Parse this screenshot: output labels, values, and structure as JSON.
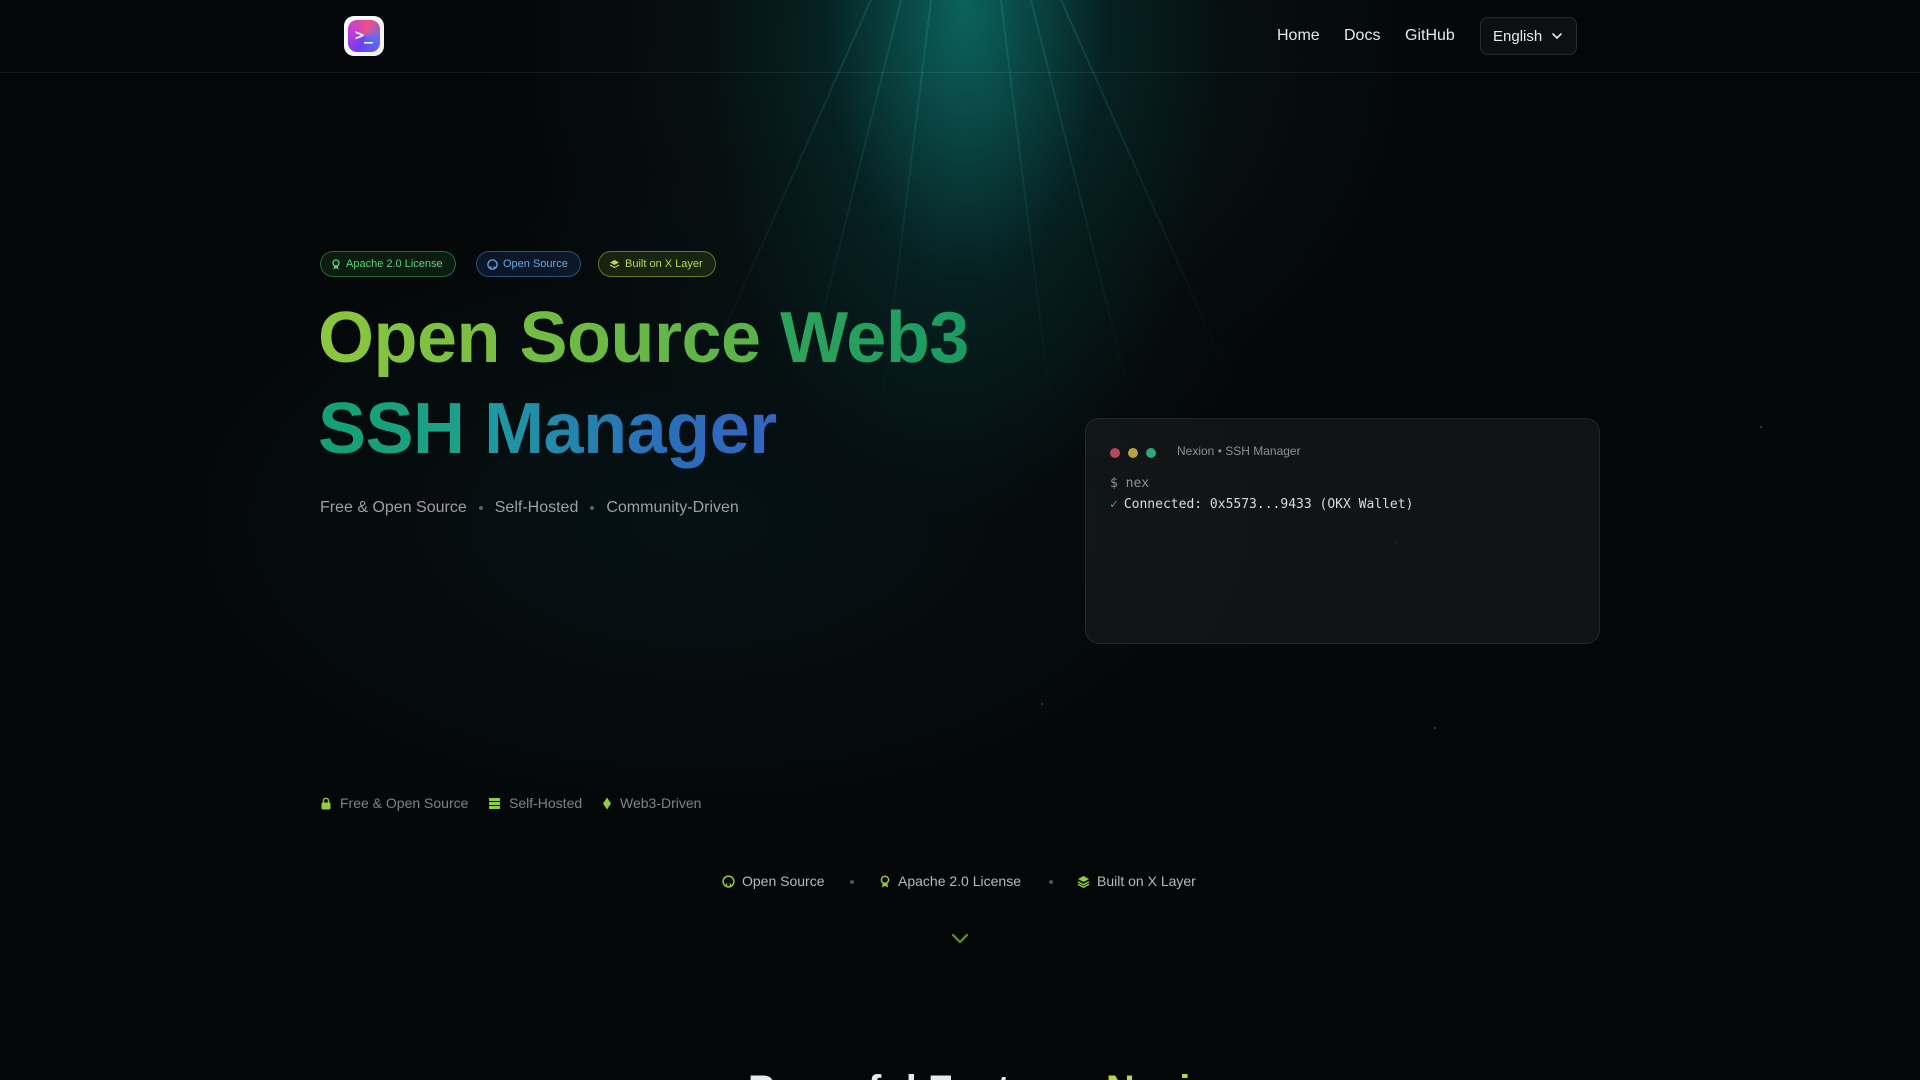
{
  "header": {
    "logo_alt": "",
    "nav": [
      {
        "label": "Home"
      },
      {
        "label": "Docs"
      },
      {
        "label": "GitHub"
      }
    ],
    "language": "English"
  },
  "hero": {
    "badges": [
      {
        "label": "Apache 2.0 License",
        "icon": "license-icon",
        "color": "#5fd07c"
      },
      {
        "label": "Open Source",
        "icon": "github-icon",
        "color": "#6aa8e8"
      },
      {
        "label": "Built on X Layer",
        "icon": "layers-icon",
        "color": "#b9d75a"
      }
    ],
    "title_part1": "Open Source",
    "title_part2": "Web3",
    "title_part3": "SSH",
    "title_part4": "Manager",
    "subtitle": [
      "Free & Open Source",
      "Self-Hosted",
      "Community-Driven"
    ]
  },
  "terminal": {
    "title": "Nexion • SSH Manager",
    "line1": "$ nex",
    "line2_check": "✓",
    "line2": "Connected: 0x5573...9433 (OKX Wallet)",
    "dot_colors": [
      "#b9475a",
      "#b5a13e",
      "#2fa67a"
    ]
  },
  "features": [
    {
      "label": "Free & Open Source",
      "icon": "lock-icon"
    },
    {
      "label": "Self-Hosted",
      "icon": "server-icon"
    },
    {
      "label": "Web3-Driven",
      "icon": "ethereum-icon"
    }
  ],
  "bottom_badges": [
    {
      "label": "Open Source",
      "icon": "github-icon"
    },
    {
      "label": "Apache 2.0 License",
      "icon": "license-icon"
    },
    {
      "label": "Built on X Layer",
      "icon": "layers-icon"
    }
  ],
  "section": {
    "heading_main": "Powerful Features",
    "heading_accent": "Nexion"
  },
  "colors": {
    "accent": "#b6d94a",
    "background": "#050607"
  }
}
